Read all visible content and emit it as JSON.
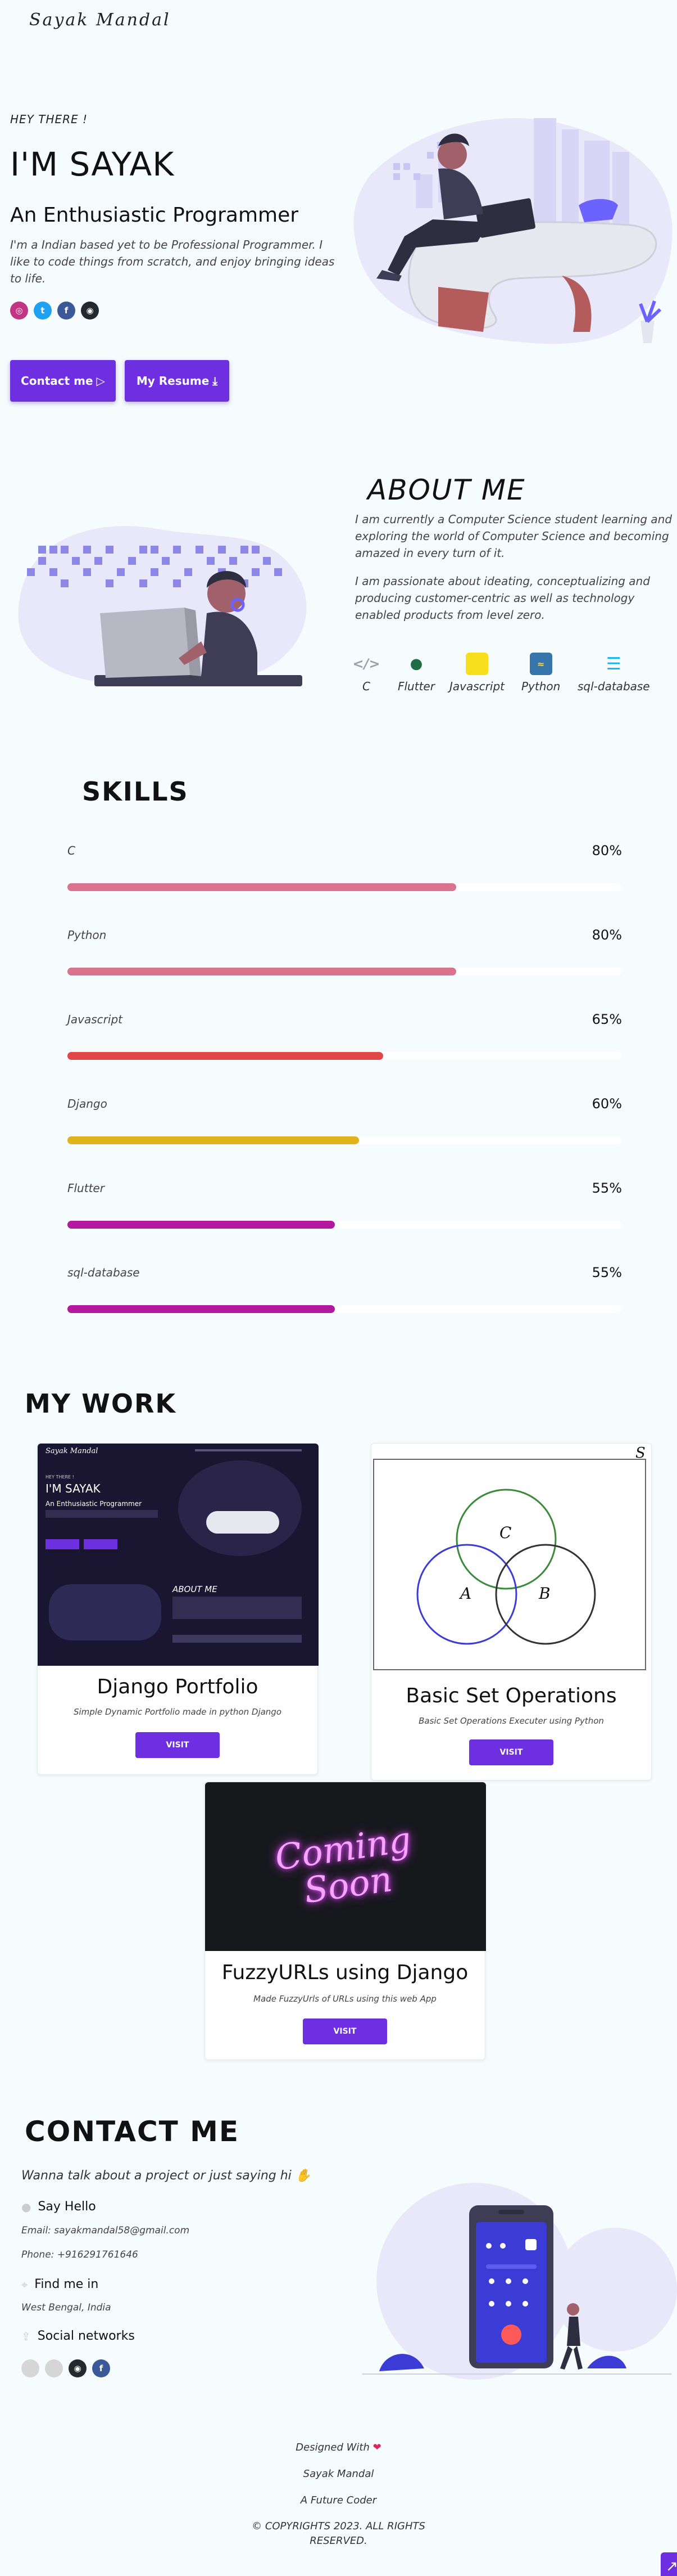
{
  "brand": {
    "logo": "Sayak Mandal"
  },
  "hero": {
    "greeting": "HEY THERE !",
    "name": "I'M SAYAK",
    "tagline": "An Enthusiastic Programmer",
    "intro": "I'm a Indian based yet to be Professional Programmer. I like to code things from scratch, and enjoy bringing ideas to life.",
    "socials": [
      {
        "icon": "instagram-icon",
        "color": "#c13584",
        "glyph": "◎"
      },
      {
        "icon": "twitter-icon",
        "color": "#1da1f2",
        "glyph": "t"
      },
      {
        "icon": "facebook-icon",
        "color": "#3b5998",
        "glyph": "f"
      },
      {
        "icon": "github-icon",
        "color": "#24292e",
        "glyph": "◉"
      }
    ],
    "contact_button": "Contact me",
    "resume_button": "My Resume"
  },
  "about": {
    "title": "ABOUT ME",
    "paragraph_1": "I am currently a Computer Science student learning and exploring the world of Computer Science and becoming amazed in every turn of it.",
    "paragraph_2": "I am passionate about ideating, conceptualizing and producing customer-centric as well as technology enabled products from level zero.",
    "tech": [
      {
        "label": "C",
        "icon": "code-icon",
        "color": "#9aa0a6"
      },
      {
        "label": "Flutter",
        "icon": "android-icon",
        "color": "#3ddc84"
      },
      {
        "label": "Javascript",
        "icon": "javascript-icon",
        "color": "#f7df1e"
      },
      {
        "label": "Python",
        "icon": "python-icon",
        "color": "#3776ab"
      },
      {
        "label": "sql-database",
        "icon": "database-icon",
        "color": "#0db7ed"
      }
    ]
  },
  "skills": {
    "title": "SKILLS",
    "items": [
      {
        "label": "C",
        "percent": 80,
        "display": "80%",
        "color": "#d9738f"
      },
      {
        "label": "Python",
        "percent": 80,
        "display": "80%",
        "color": "#d9738f"
      },
      {
        "label": "Javascript",
        "percent": 65,
        "display": "65%",
        "color": "#e04848"
      },
      {
        "label": "Django",
        "percent": 60,
        "display": "60%",
        "color": "#e2b21c"
      },
      {
        "label": "Flutter",
        "percent": 55,
        "display": "55%",
        "color": "#b2199e"
      },
      {
        "label": "sql-database",
        "percent": 55,
        "display": "55%",
        "color": "#b2199e"
      }
    ]
  },
  "work": {
    "title": "MY WORK",
    "projects": [
      {
        "title": "Django Portfolio",
        "subtitle": "Simple Dynamic Portfolio made in python Django",
        "button": "VISIT"
      },
      {
        "title": "Basic Set Operations",
        "subtitle": "Basic Set Operations Executer using Python",
        "button": "VISIT"
      },
      {
        "title": "FuzzyURLs using Django",
        "subtitle": "Made FuzzyUrls of URLs using this web App",
        "button": "VISIT"
      }
    ],
    "venn": {
      "corner": "S",
      "labels": [
        "C",
        "A",
        "B"
      ]
    },
    "coming_soon": "Coming Soon",
    "mini_preview": {
      "logo": "Sayak Mandal",
      "greeting": "HEY THERE !",
      "name": "I'M SAYAK",
      "tagline": "An Enthusiastic Programmer",
      "about": "ABOUT ME"
    }
  },
  "contact": {
    "title": "CONTACT ME",
    "lead": "Wanna talk about a project or just saying hi",
    "say_hello": "Say Hello",
    "email": "Email: sayakmandal58@gmail.com",
    "phone": "Phone: +916291761646",
    "find_me": "Find me in",
    "location": "West Bengal, India",
    "social_networks": "Social networks"
  },
  "footer": {
    "designed_with": "Designed With",
    "name": "Sayak Mandal",
    "motto": "A Future Coder",
    "copyright_1": "© COPYRIGHTS 2023. ALL RIGHTS",
    "copyright_2": "RESERVED."
  },
  "colors": {
    "accent": "#6d2fe0",
    "background": "#f6fcfd"
  }
}
